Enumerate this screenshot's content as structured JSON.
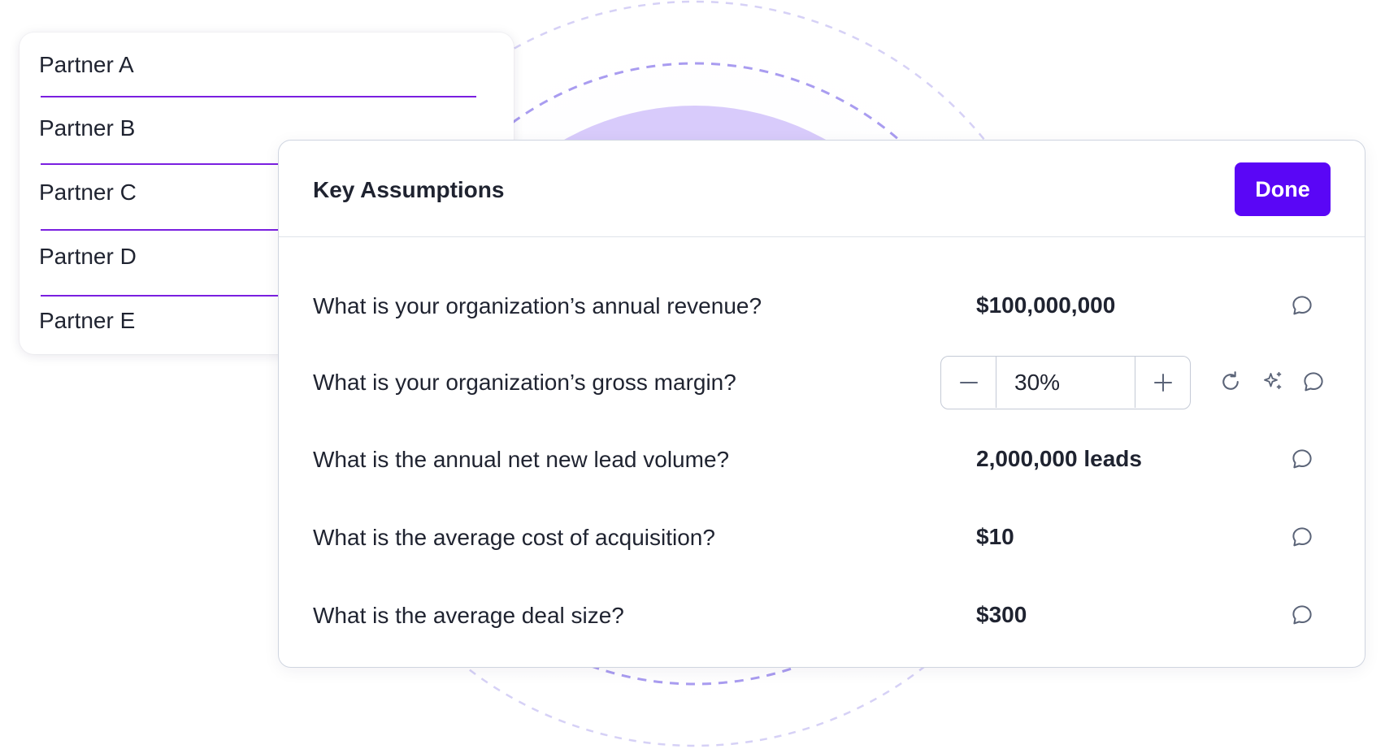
{
  "partners": [
    {
      "label": "Partner A"
    },
    {
      "label": "Partner B"
    },
    {
      "label": "Partner C"
    },
    {
      "label": "Partner D"
    },
    {
      "label": "Partner E"
    }
  ],
  "modal": {
    "title": "Key Assumptions",
    "done_label": "Done",
    "rows": [
      {
        "question": "What is your organization’s annual revenue?",
        "answer": "$100,000,000"
      },
      {
        "question": "What is your organization’s gross margin?",
        "answer": "30%"
      },
      {
        "question": "What is the annual net new lead volume?",
        "answer": "2,000,000 leads"
      },
      {
        "question": "What is the average cost of acquisition?",
        "answer": "$10"
      },
      {
        "question": "What is the average deal size?",
        "answer": "$300"
      }
    ]
  },
  "icons": {
    "comment": "comment-icon",
    "minus": "minus-icon",
    "plus": "plus-icon",
    "reset": "refresh-icon",
    "ai": "sparkle-icon"
  },
  "colors": {
    "accent": "#5a06f6",
    "underline": "#7a1fe0",
    "deco_fill": "#d9cdfb",
    "deco_dash": "#c9c3f2"
  }
}
